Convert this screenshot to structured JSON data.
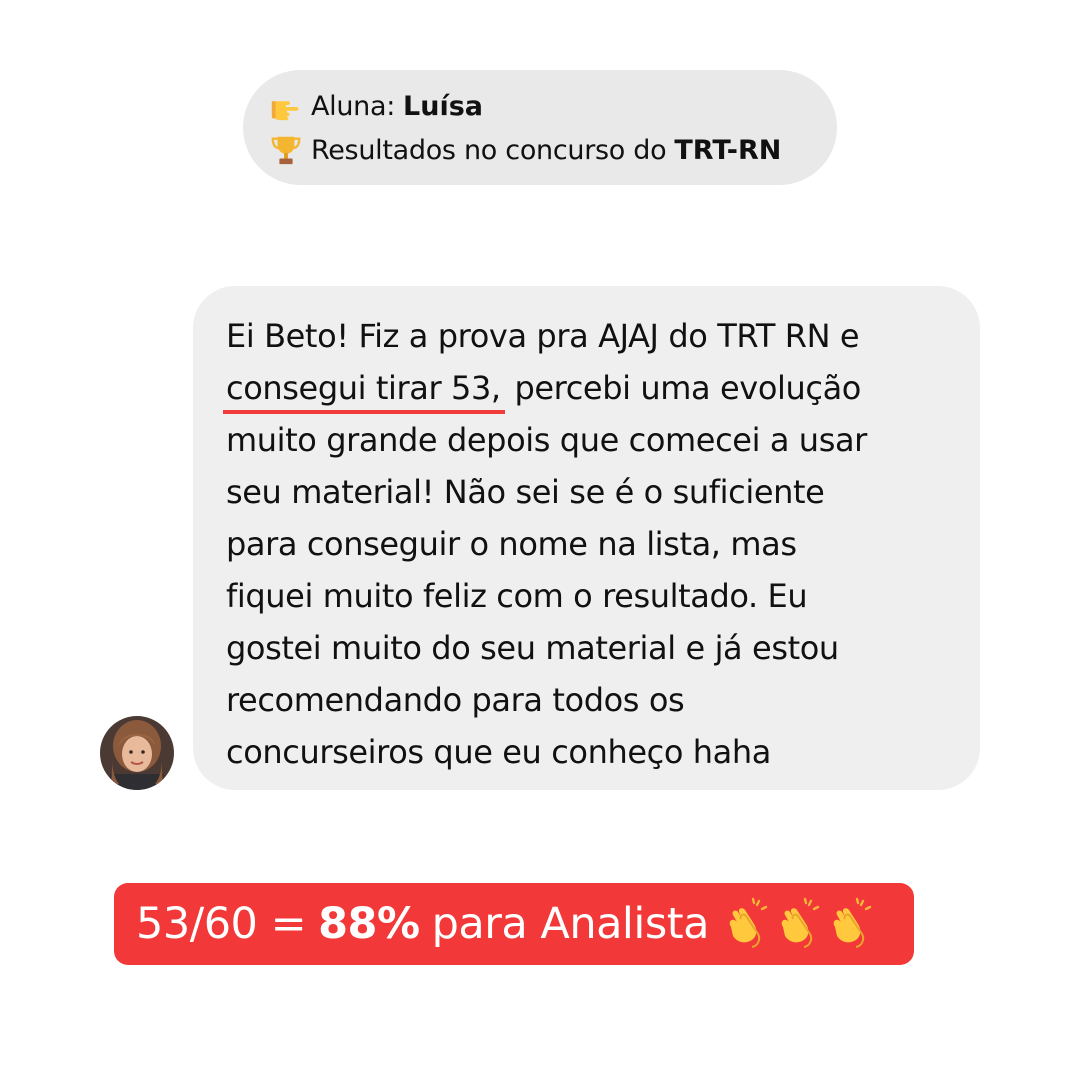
{
  "header": {
    "line1_label": "Aluna:",
    "line1_value": "Luísa",
    "line1_icon": "pointing-right-hand-icon",
    "line2_label": "Resultados no concurso do",
    "line2_value": "TRT-RN",
    "line2_icon": "trophy-icon"
  },
  "message": {
    "line1": "Ei Beto! Fiz a prova pra AJAJ do TRT RN e",
    "line2_highlight": "consegui tirar 53,",
    "line2_rest": " percebi uma evolução",
    "line3": "muito grande depois que comecei a usar",
    "line4": "seu material! Não sei se é o suficiente",
    "line5": "para conseguir o nome na lista, mas",
    "line6": "fiquei muito feliz com o resultado. Eu",
    "line7": "gostei muito do seu material e já estou",
    "line8": "recomendando para todos os",
    "line9": "concurseiros que eu conheço haha"
  },
  "result": {
    "fraction": "53/60 =",
    "percent": "88%",
    "label": "para Analista",
    "icon": "clapping-hands-icon"
  },
  "colors": {
    "accent": "#f23838",
    "bubble": "#efefef",
    "pill": "#e9e9e9"
  }
}
